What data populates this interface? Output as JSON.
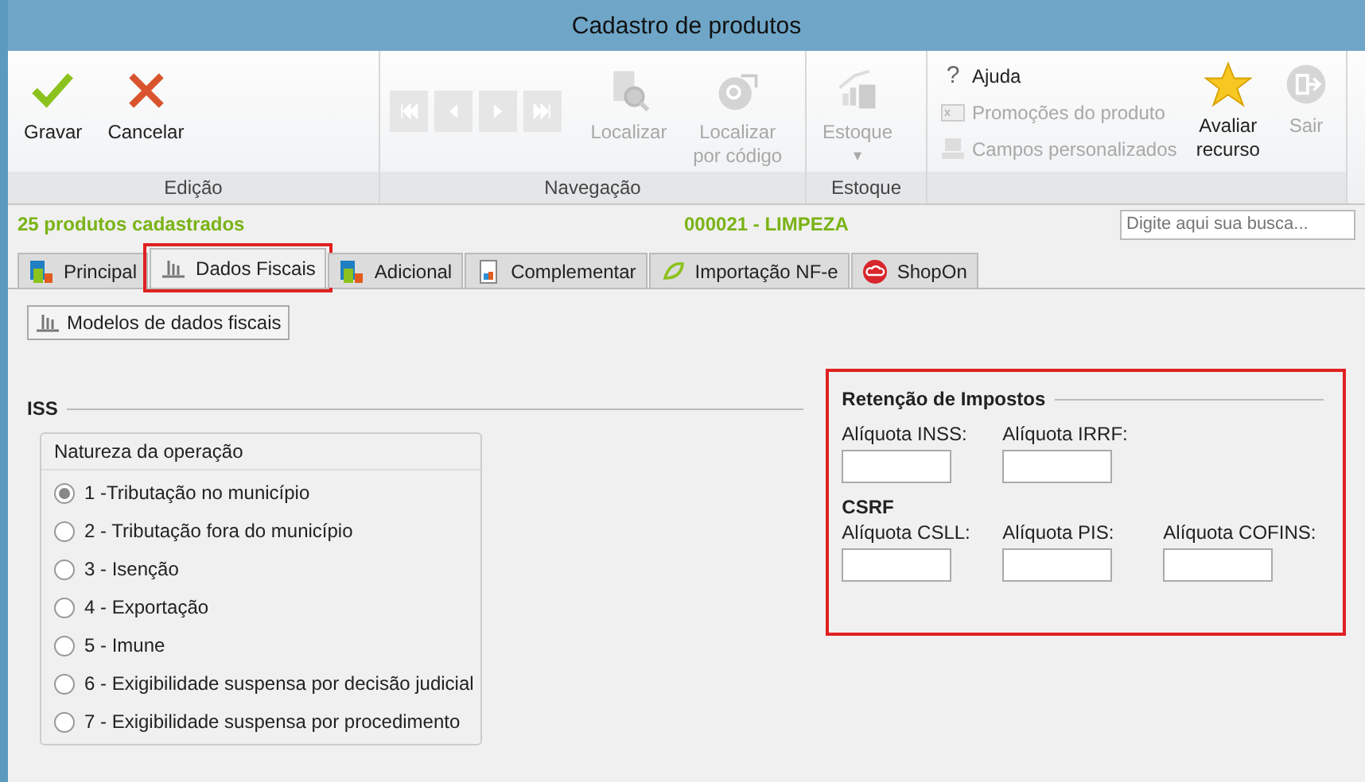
{
  "window": {
    "title": "Cadastro de produtos"
  },
  "ribbon": {
    "groups": [
      {
        "label": "Edição",
        "items": [
          {
            "kind": "big",
            "label": "Gravar",
            "disabled": false
          },
          {
            "kind": "big",
            "label": "Cancelar",
            "disabled": false
          }
        ]
      },
      {
        "label": "Navegação",
        "items": [
          {
            "kind": "nav",
            "disabled": true
          },
          {
            "kind": "nav",
            "disabled": true
          },
          {
            "kind": "nav",
            "disabled": true
          },
          {
            "kind": "nav",
            "disabled": true
          },
          {
            "kind": "big",
            "label": "Localizar",
            "disabled": true
          },
          {
            "kind": "big",
            "label": "Localizar por código",
            "disabled": true
          }
        ]
      },
      {
        "label": "Estoque",
        "items": [
          {
            "kind": "big",
            "label": "Estoque",
            "dropdown": "▾",
            "disabled": true
          }
        ]
      },
      {
        "items": [
          {
            "kind": "small",
            "glyph": "?",
            "label": "Ajuda",
            "disabled": false
          },
          {
            "kind": "small",
            "label": "Promoções do produto",
            "disabled": true
          },
          {
            "kind": "small",
            "label": "Campos personalizados",
            "disabled": true
          },
          {
            "kind": "big",
            "label": "Avaliar recurso",
            "disabled": false
          },
          {
            "kind": "big",
            "label": "Sair",
            "disabled": true
          }
        ]
      }
    ]
  },
  "status": {
    "count": "25 produtos cadastrados",
    "product": "000021 - LIMPEZA",
    "search": {
      "placeholder": "Digite aqui sua busca..."
    }
  },
  "tabs": [
    {
      "label": "Principal",
      "selected": false,
      "highlighted": false
    },
    {
      "label": "Dados Fiscais",
      "selected": true,
      "highlighted": true
    },
    {
      "label": "Adicional",
      "selected": false,
      "highlighted": false
    },
    {
      "label": "Complementar",
      "selected": false,
      "highlighted": false
    },
    {
      "label": "Importação NF-e",
      "selected": false,
      "highlighted": false
    },
    {
      "label": "ShopOn",
      "selected": false,
      "highlighted": false
    }
  ],
  "models_button": "Modelos de dados fiscais",
  "iss": {
    "title": "ISS",
    "group_title": "Natureza da operação",
    "options": [
      {
        "label": "1 -Tributação no município",
        "selected": true
      },
      {
        "label": "2 - Tributação fora do município",
        "selected": false
      },
      {
        "label": "3 - Isenção",
        "selected": false
      },
      {
        "label": "4 - Exportação",
        "selected": false
      },
      {
        "label": "5 - Imune",
        "selected": false
      },
      {
        "label": "6 - Exigibilidade suspensa por decisão judicial",
        "selected": false
      },
      {
        "label": "7 - Exigibilidade suspensa por procedimento",
        "selected": false
      }
    ]
  },
  "retention": {
    "title": "Retenção de Impostos",
    "highlighted": true,
    "rows": [
      {
        "fields": [
          {
            "label": "Alíquota INSS:"
          },
          {
            "label": "Alíquota IRRF:"
          }
        ]
      },
      {
        "heading": "CSRF",
        "fields": [
          {
            "label": "Alíquota CSLL:"
          },
          {
            "label": "Alíquota PIS:"
          },
          {
            "label": "Alíquota COFINS:"
          }
        ]
      }
    ]
  }
}
